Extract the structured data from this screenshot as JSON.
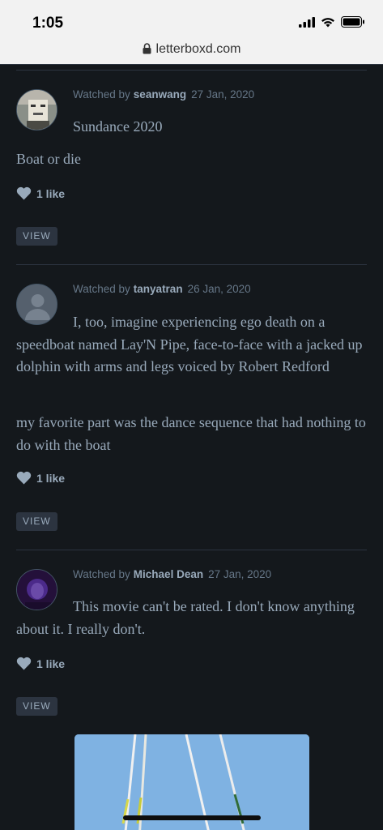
{
  "status_bar": {
    "time": "1:05"
  },
  "browser": {
    "url": "letterboxd.com"
  },
  "entries": [
    {
      "watched_by_label": "Watched by",
      "user": "seanwang",
      "date": "27 Jan, 2020",
      "review_paragraphs": [
        "Sundance 2020",
        "Boat or die"
      ],
      "likes": "1 like",
      "view_label": "VIEW"
    },
    {
      "watched_by_label": "Watched by",
      "user": "tanyatran",
      "date": "26 Jan, 2020",
      "review_paragraphs": [
        "I, too, imagine experiencing ego death on a speedboat named Lay'N Pipe, face-to-face with a jacked up dolphin with arms and legs voiced by Robert Redford",
        "my favorite part was the dance sequence that had nothing to do with the boat"
      ],
      "likes": "1 like",
      "view_label": "VIEW"
    },
    {
      "watched_by_label": "Watched by",
      "user": "Michael Dean",
      "date": "27 Jan, 2020",
      "review_paragraphs": [
        "This movie can't be rated. I don't know anything about it. I really don't."
      ],
      "likes": "1 like",
      "view_label": "VIEW"
    }
  ],
  "colors": {
    "background": "#14181c",
    "meta_text": "#667788",
    "username": "#99aabb",
    "body_text": "#99aabb"
  }
}
